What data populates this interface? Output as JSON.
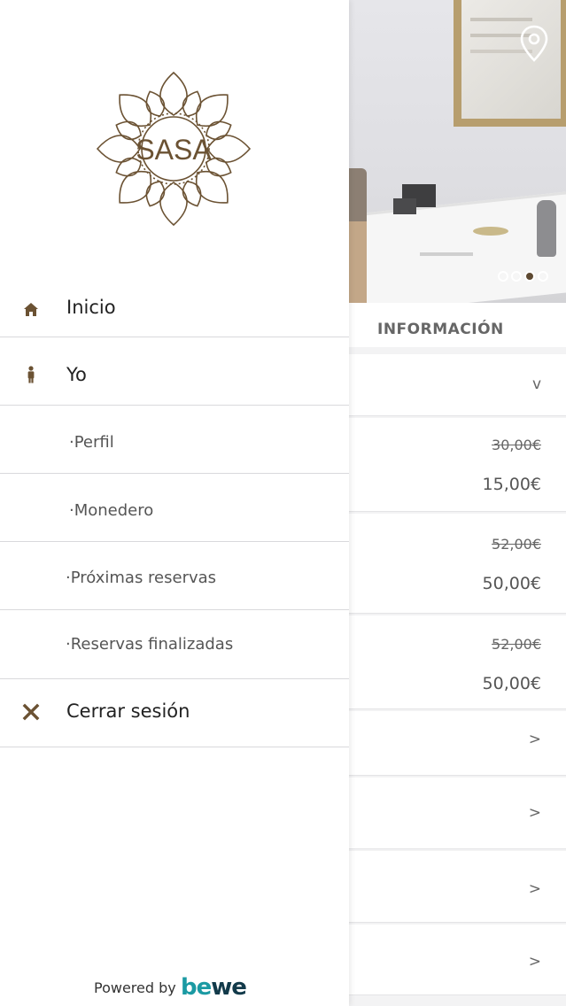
{
  "drawer": {
    "brand_text": "SASA",
    "menu": {
      "home_label": "Inicio",
      "me_label": "Yo",
      "profile_label": "·Perfil",
      "wallet_label": "·Monedero",
      "upcoming_label": "·Próximas reservas",
      "finished_label": "·Reservas finalizadas",
      "logout_label": "Cerrar sesión"
    },
    "footer": {
      "powered_label": "Powered by",
      "bewe_part1": "be",
      "bewe_part2": "we"
    }
  },
  "background": {
    "section_title": "INFORMACIÓN",
    "expand_arrow": "v",
    "carousel": {
      "total": 4,
      "active_index": 2
    },
    "prices": [
      {
        "old": "30,00€",
        "new": "15,00€"
      },
      {
        "old": "52,00€",
        "new": "50,00€"
      },
      {
        "old": "52,00€",
        "new": "50,00€"
      }
    ],
    "arrows": [
      ">",
      ">",
      ">",
      ">"
    ]
  },
  "colors": {
    "brand_brown": "#6b5233",
    "accent_teal": "#1b9aa3"
  }
}
